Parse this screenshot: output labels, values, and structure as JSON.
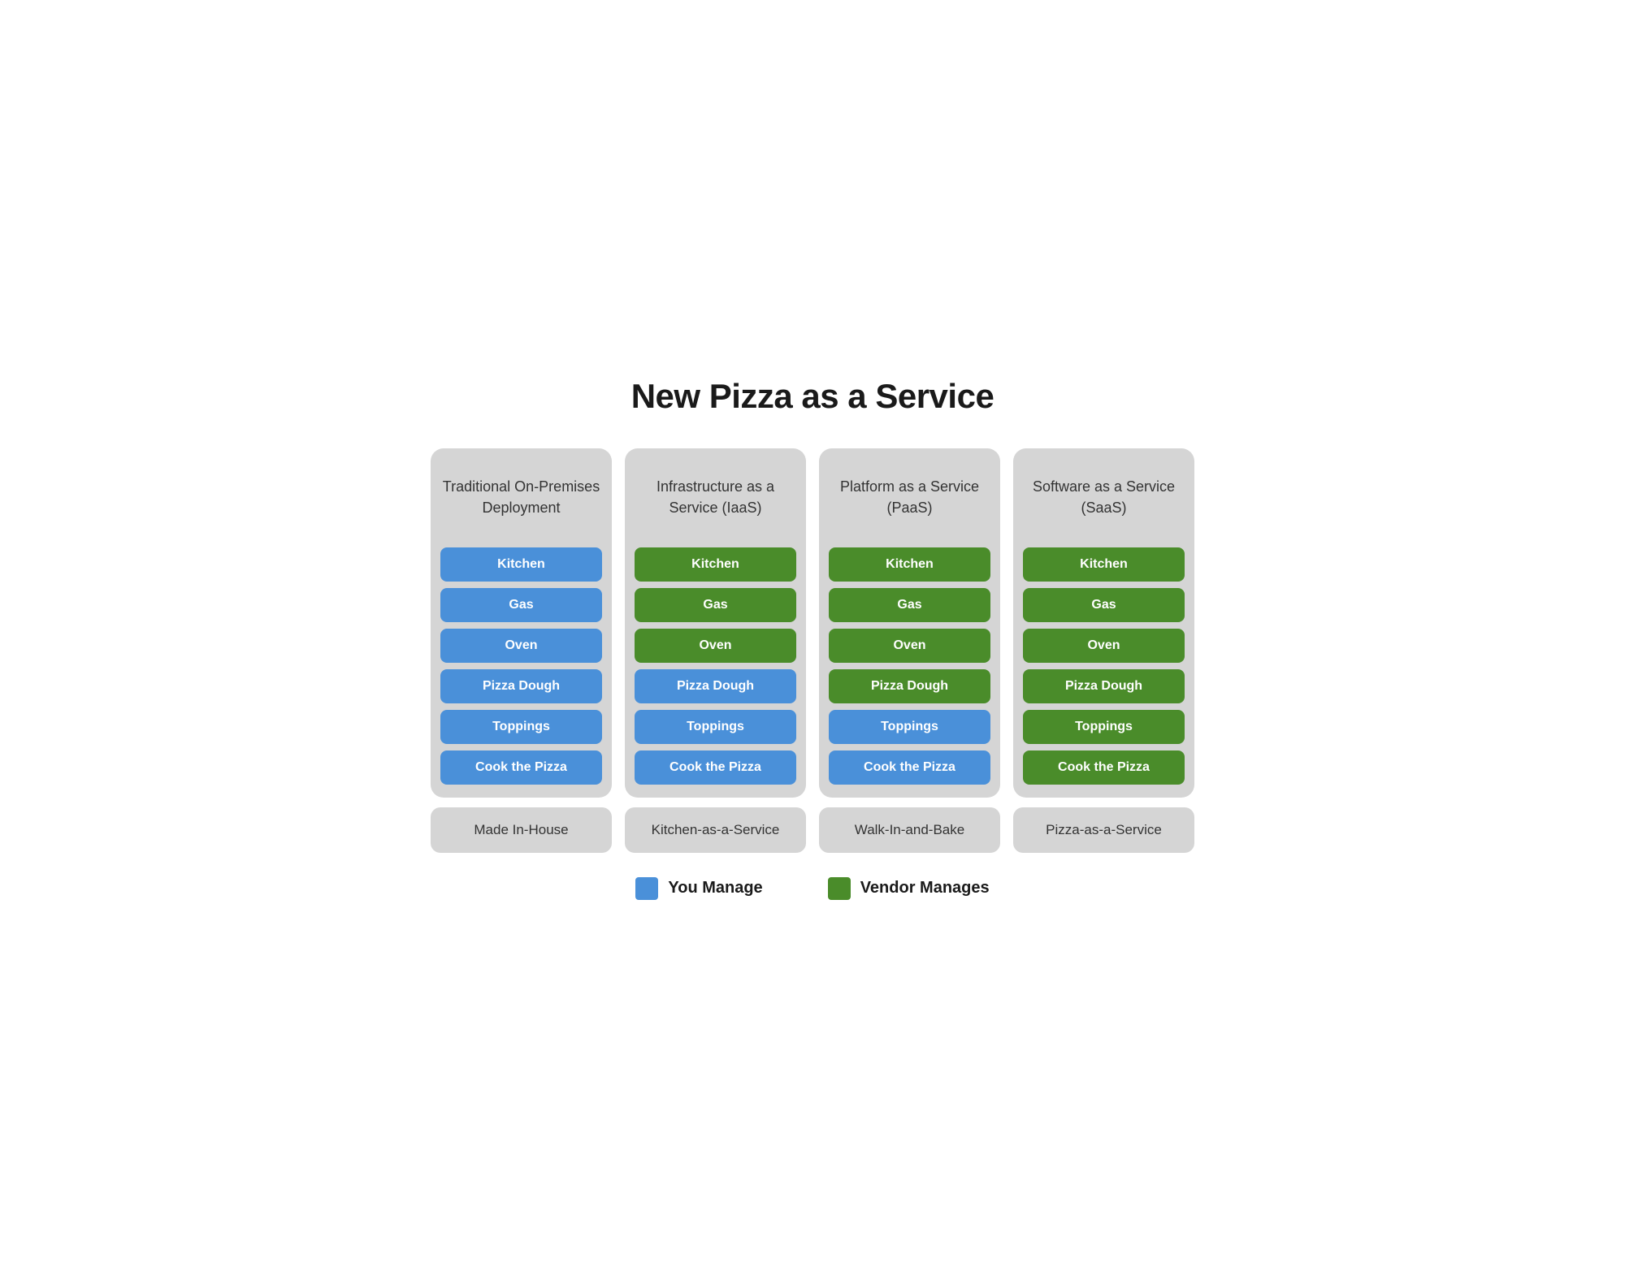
{
  "title": "New Pizza as a Service",
  "columns": [
    {
      "id": "traditional",
      "title": "Traditional\nOn-Premises\nDeployment",
      "footer": "Made In-House",
      "items": [
        {
          "label": "Kitchen",
          "type": "blue"
        },
        {
          "label": "Gas",
          "type": "blue"
        },
        {
          "label": "Oven",
          "type": "blue"
        },
        {
          "label": "Pizza Dough",
          "type": "blue"
        },
        {
          "label": "Toppings",
          "type": "blue"
        },
        {
          "label": "Cook the Pizza",
          "type": "blue"
        }
      ]
    },
    {
      "id": "iaas",
      "title": "Infrastructure\nas a Service\n(IaaS)",
      "footer": "Kitchen-as-a-Service",
      "items": [
        {
          "label": "Kitchen",
          "type": "green"
        },
        {
          "label": "Gas",
          "type": "green"
        },
        {
          "label": "Oven",
          "type": "green"
        },
        {
          "label": "Pizza Dough",
          "type": "blue"
        },
        {
          "label": "Toppings",
          "type": "blue"
        },
        {
          "label": "Cook the Pizza",
          "type": "blue"
        }
      ]
    },
    {
      "id": "paas",
      "title": "Platform\nas a Service\n(PaaS)",
      "footer": "Walk-In-and-Bake",
      "items": [
        {
          "label": "Kitchen",
          "type": "green"
        },
        {
          "label": "Gas",
          "type": "green"
        },
        {
          "label": "Oven",
          "type": "green"
        },
        {
          "label": "Pizza Dough",
          "type": "green"
        },
        {
          "label": "Toppings",
          "type": "blue"
        },
        {
          "label": "Cook the Pizza",
          "type": "blue"
        }
      ]
    },
    {
      "id": "saas",
      "title": "Software\nas a Service\n(SaaS)",
      "footer": "Pizza-as-a-Service",
      "items": [
        {
          "label": "Kitchen",
          "type": "green"
        },
        {
          "label": "Gas",
          "type": "green"
        },
        {
          "label": "Oven",
          "type": "green"
        },
        {
          "label": "Pizza Dough",
          "type": "green"
        },
        {
          "label": "Toppings",
          "type": "green"
        },
        {
          "label": "Cook the Pizza",
          "type": "green"
        }
      ]
    }
  ],
  "legend": {
    "you_manage": "You Manage",
    "vendor_manages": "Vendor Manages"
  }
}
